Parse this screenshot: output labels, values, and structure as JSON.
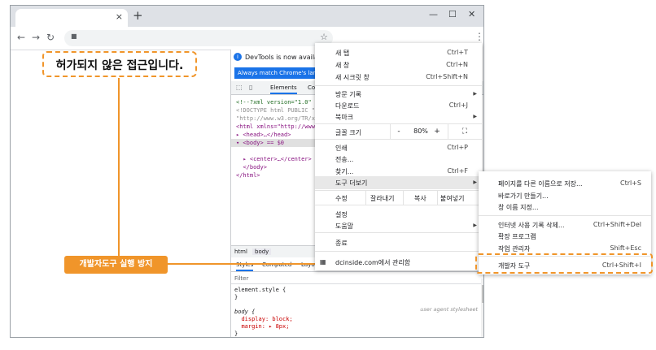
{
  "browser": {
    "new_tab_icon": "+",
    "tab_close_icon": "×",
    "window_controls": [
      "—",
      "☐",
      "✕"
    ]
  },
  "callout": {
    "blocked_text": "허가되지 않은 접근입니다."
  },
  "devtools": {
    "info_text": "DevTools is now available",
    "info_button": "Always match Chrome's lang",
    "tabs": [
      "Elements",
      "Co"
    ],
    "code_lines": {
      "l1": "<!--?xml version=\"1.0\"",
      "l2": "<!DOCTYPE html PUBLIC \"",
      "l3": "\"http://www.w3.org/TR/x",
      "l4": "<html xmlns=\"http://www.",
      "l5": "▸ <head>…</head>",
      "l6": "▾ <body> == $0",
      "l7": "▸ <center>…</center>",
      "l8": "</body>",
      "l9": "</html>"
    },
    "crumbs": [
      "html",
      "body"
    ],
    "style_tabs": [
      "Styles",
      "Computed",
      "Layou"
    ],
    "filter_placeholder": "Filter",
    "styles": {
      "element_style": "element.style {",
      "close1": "}",
      "body_rule": "body {",
      "display": "display: block;",
      "margin": "margin: ▸ 8px;",
      "close2": "}",
      "ua_label": "user agent stylesheet"
    }
  },
  "menu": {
    "items": {
      "new_tab": "새 탭",
      "new_tab_sc": "Ctrl+T",
      "new_window": "새 창",
      "new_window_sc": "Ctrl+N",
      "incognito": "새 시크릿 창",
      "incognito_sc": "Ctrl+Shift+N",
      "history": "방문 기록",
      "downloads": "다운로드",
      "downloads_sc": "Ctrl+J",
      "bookmarks": "북마크",
      "font_size": "글꼴 크기",
      "zoom_minus": "-",
      "zoom_value": "80%",
      "zoom_plus": "+",
      "print": "인쇄",
      "print_sc": "Ctrl+P",
      "cast": "전송...",
      "find": "찾기...",
      "find_sc": "Ctrl+F",
      "more_tools": "도구 더보기",
      "edit": "수정",
      "cut": "잘라내기",
      "copy": "복사",
      "paste": "붙여넣기",
      "settings": "설정",
      "help": "도움말",
      "exit": "종료",
      "managed": "dcinside.com에서 관리함"
    }
  },
  "submenu": {
    "items": {
      "save_as": "페이지를 다른 이름으로 저장...",
      "save_as_sc": "Ctrl+S",
      "shortcut": "바로가기 만들기...",
      "name_window": "창 이름 지정...",
      "clear_data": "인터넷 사용 기록 삭제...",
      "clear_data_sc": "Ctrl+Shift+Del",
      "extensions": "확장 프로그램",
      "task_manager": "작업 관리자",
      "task_manager_sc": "Shift+Esc",
      "dev_tools": "개발자 도구",
      "dev_tools_sc": "Ctrl+Shift+I"
    }
  },
  "annotation": {
    "label": "개발자도구 실행 방지"
  },
  "colors": {
    "accent_orange": "#f0952a",
    "chrome_blue": "#1a73e8"
  }
}
